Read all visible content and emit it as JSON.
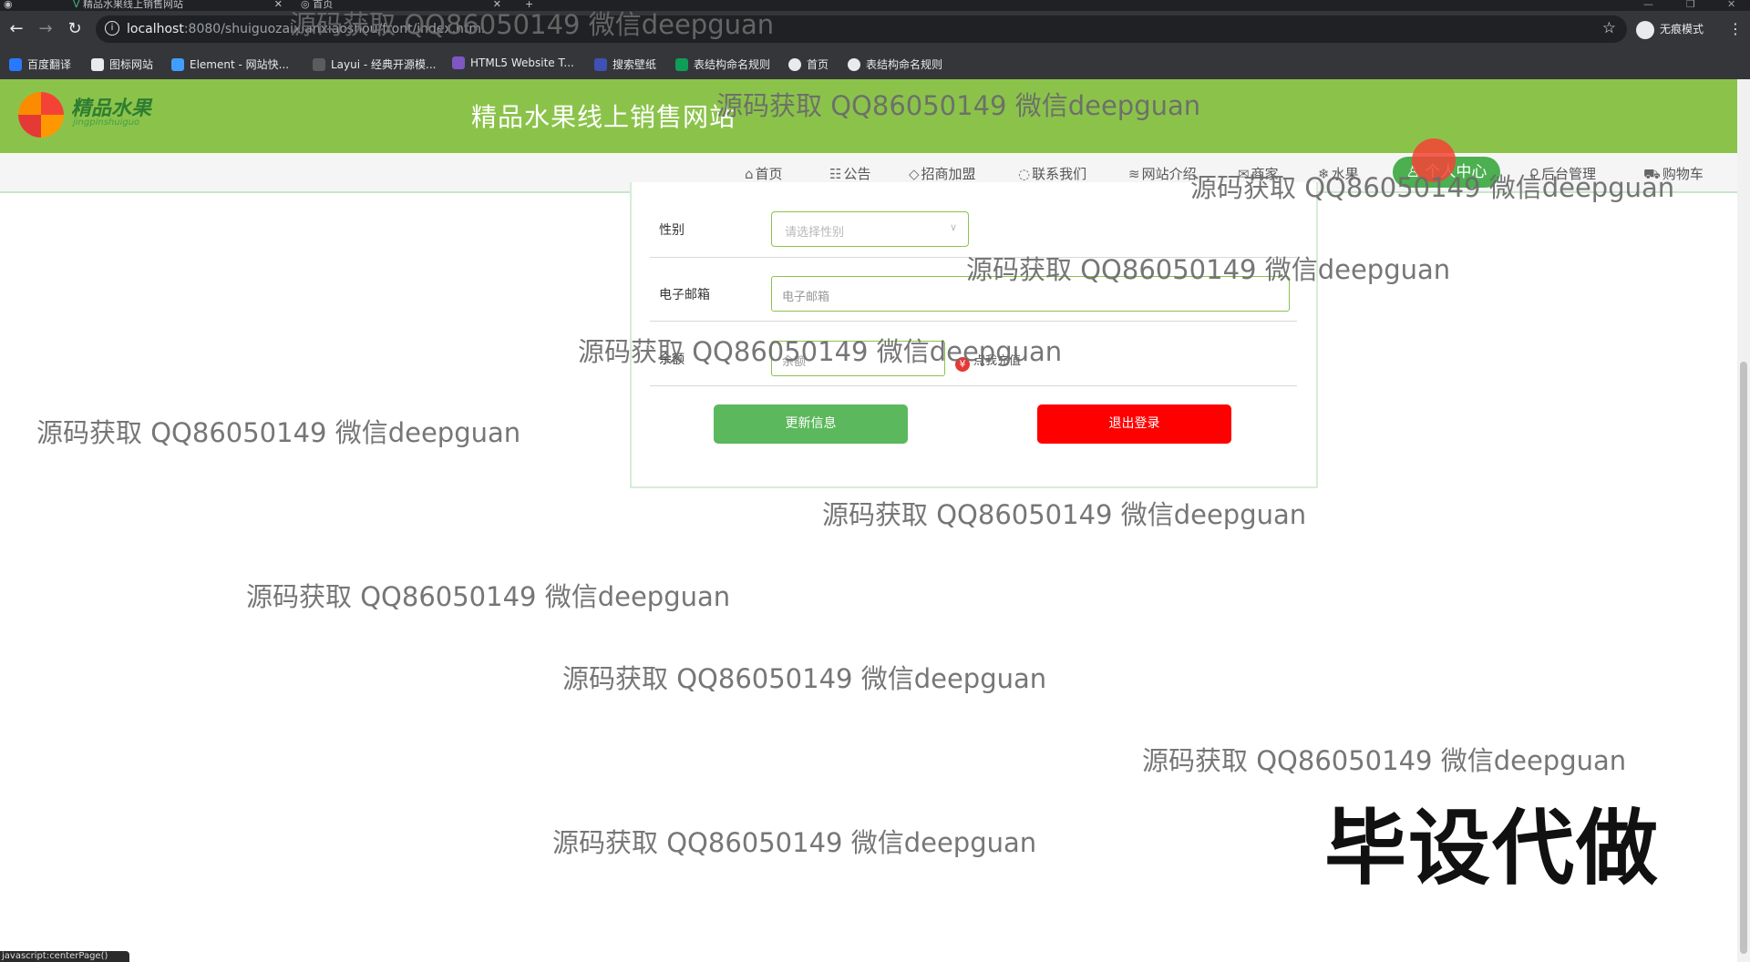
{
  "browser": {
    "tabs": [
      {
        "title": "精品水果线上销售网站"
      },
      {
        "title": "首页"
      }
    ],
    "new_tab": "+",
    "url_host": "localhost",
    "url_path": ":8080/shuiguozaixianxiaoshou/front/index.html",
    "incognito_label": "无痕模式",
    "bookmarks": [
      "百度翻译",
      "图标网站",
      "Element - 网站快...",
      "Layui - 经典开源模...",
      "HTML5 Website T...",
      "搜索壁纸",
      "表结构命名规则",
      "首页",
      "表结构命名规则"
    ]
  },
  "site": {
    "logo_text": "精品水果",
    "logo_sub": "jingpinshuiguo",
    "title": "精品水果线上销售网站"
  },
  "nav": {
    "items": [
      "首页",
      "公告",
      "招商加盟",
      "联系我们",
      "网站介绍",
      "商家",
      "水果"
    ],
    "active": "个人中心",
    "right_items": [
      "后台管理",
      "购物车"
    ]
  },
  "form": {
    "gender_label": "性别",
    "gender_placeholder": "请选择性别",
    "email_label": "电子邮箱",
    "email_placeholder": "电子邮箱",
    "balance_label": "余额",
    "balance_placeholder": "余额",
    "recharge_label": "点我充值",
    "update_button": "更新信息",
    "logout_button": "退出登录"
  },
  "watermark": "源码获取 QQ86050149 微信deepguan",
  "promo_text": "毕设代做",
  "status_text": "javascript:centerPage()",
  "colors": {
    "header_green": "#8bc34a",
    "active_green": "#4caf50",
    "update_green": "#5cb85c",
    "logout_red": "#ff0000"
  }
}
